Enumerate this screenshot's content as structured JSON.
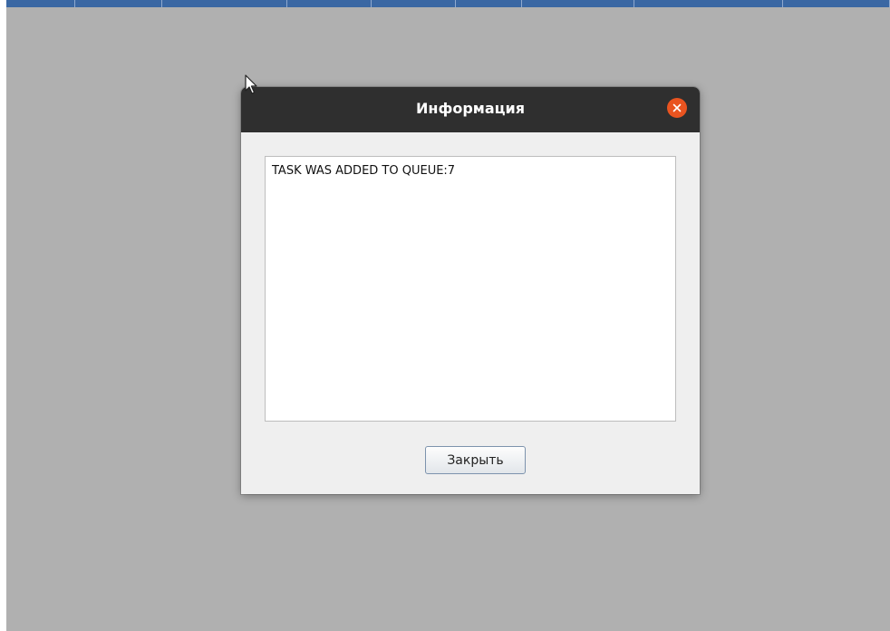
{
  "dialog": {
    "title": "Информация",
    "message": "TASK WAS ADDED TO QUEUE:7",
    "close_button_label": "Закрыть",
    "close_icon": "close-icon"
  },
  "colors": {
    "titlebar": "#2f2f2f",
    "close_accent": "#e95420",
    "backdrop": "#b0b0b0",
    "top_strip": "#3a67a3"
  }
}
